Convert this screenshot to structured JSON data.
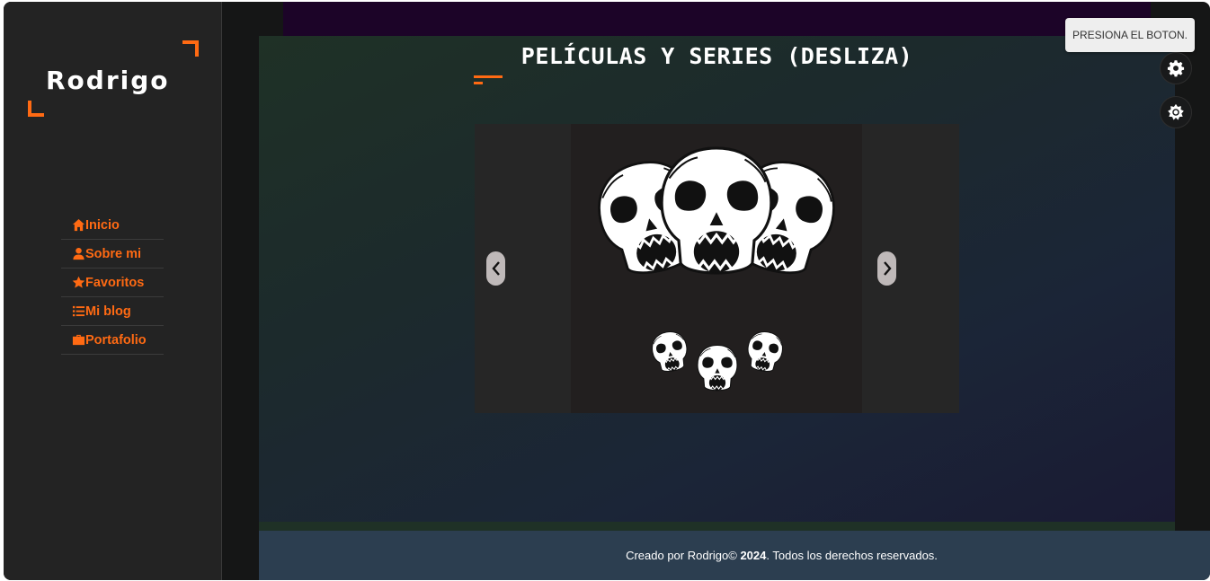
{
  "brand": {
    "logo_text": "Rodrigo",
    "accent_color": "#ff6a13"
  },
  "nav": {
    "items": [
      {
        "label": "Inicio",
        "icon": "home-icon"
      },
      {
        "label": "Sobre mi",
        "icon": "user-icon"
      },
      {
        "label": " Favoritos",
        "icon": "star-icon"
      },
      {
        "label": "Mi blog",
        "icon": "list-icon"
      },
      {
        "label": "Portafolio",
        "icon": "briefcase-icon"
      }
    ]
  },
  "main": {
    "title": "PELÍCULAS Y SERIES (DESLIZA)",
    "carousel": {
      "prev_icon": "chevron-left-icon",
      "next_icon": "chevron-right-icon",
      "image": "skulls-illustration"
    }
  },
  "footer": {
    "text_prefix": "Creado por Rodrigo© ",
    "year": "2024",
    "text_suffix": ". Todos los derechos reservados."
  },
  "controls": {
    "tooltip": "PRESIONA EL BOTON.",
    "settings_icon": "gear-icon",
    "theme_icon": "sun-icon"
  },
  "colors": {
    "sidebar": "#232323",
    "footer": "#2c3e50",
    "topbar": "#1c0428"
  }
}
